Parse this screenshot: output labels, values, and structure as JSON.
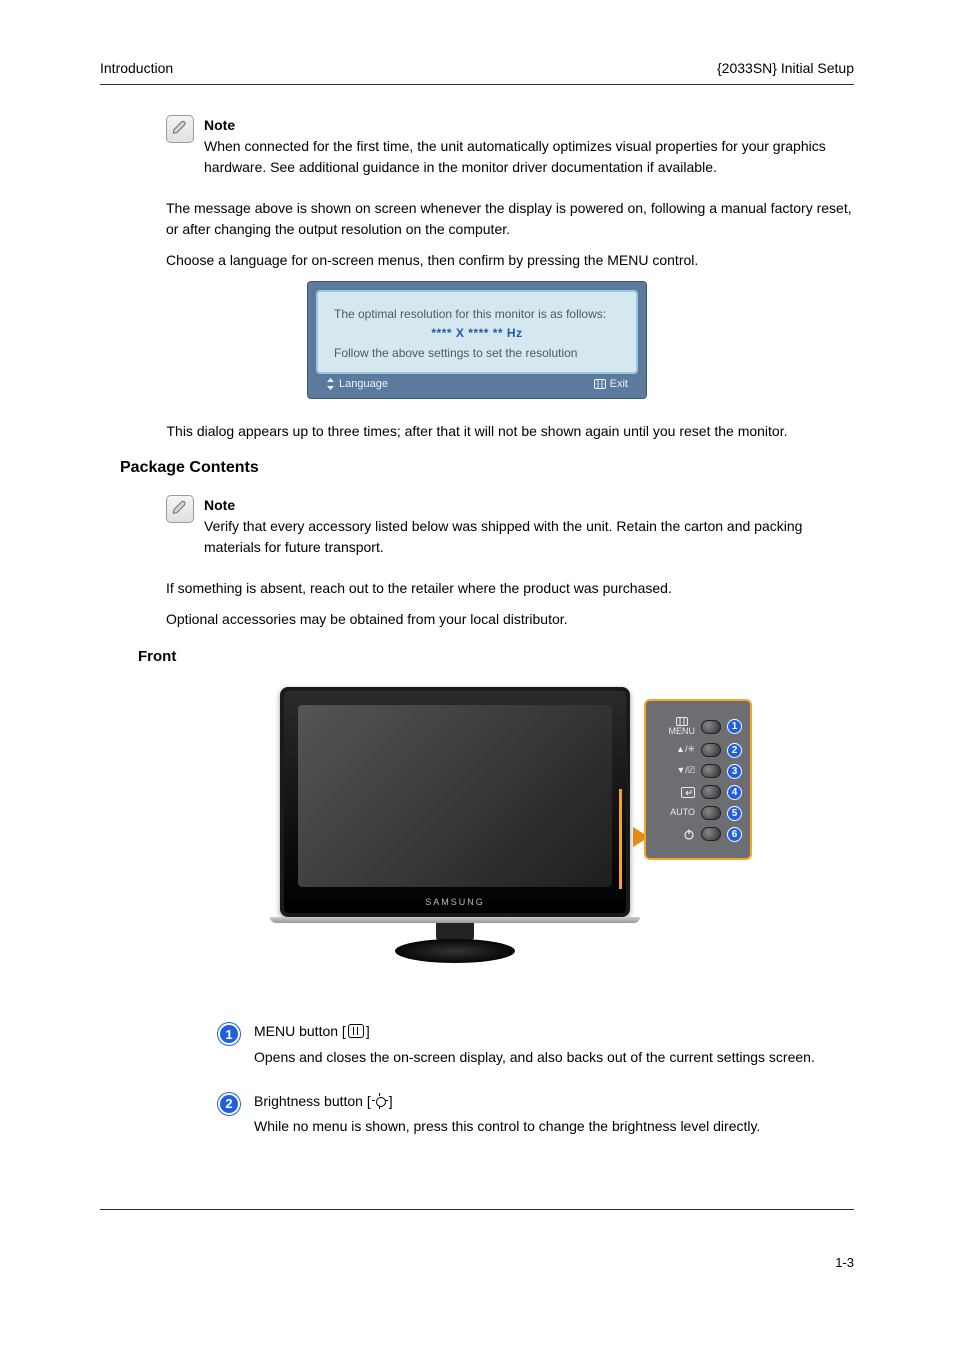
{
  "header": {
    "left": "Introduction",
    "right": "{2033SN} Initial Setup"
  },
  "footer": {
    "page_label": "1-3"
  },
  "osd": {
    "line1": "The optimal resolution for this monitor is as follows:",
    "res": "**** X **** ** Hz",
    "line2": "Follow the above settings to set the resolution",
    "bar_left_icon": "updown-icon",
    "bar_left": "Language",
    "bar_right_icon": "menu-icon",
    "bar_right": "Exit"
  },
  "sec1": {
    "note_label": "Note",
    "note": "When connected for the first time, the unit automatically optimizes visual properties for your graphics hardware. See additional guidance in the monitor driver documentation if available.",
    "p1": "The message above is shown on screen whenever the display is powered on, following a manual factory reset, or after changing the output resolution on the computer.",
    "p2": "Choose a language for on-screen menus, then confirm by pressing the MENU control.",
    "p3": "This dialog appears up to three times; after that it will not be shown again until you reset the monitor."
  },
  "sec2": {
    "title": "Package Contents",
    "note_label": "Note",
    "note": "Verify that every accessory listed below was shipped with the unit. Retain the carton and packing materials for future transport.",
    "p1": "If something is absent, reach out to the retailer where the product was purchased.",
    "p2": "Optional accessories may be obtained from your local distributor.",
    "subheading": "Front",
    "brand": "SAMSUNG"
  },
  "panel": {
    "rows": [
      {
        "label": "MENU",
        "icon": "menu-tiny-icon",
        "num": "1"
      },
      {
        "label": "▲/✳",
        "icon": "",
        "num": "2"
      },
      {
        "label": "▼/⎚",
        "icon": "",
        "num": "3"
      },
      {
        "label": "↵",
        "icon": "enter-icon",
        "num": "4"
      },
      {
        "label": "AUTO",
        "icon": "",
        "num": "5"
      },
      {
        "label": "⏻",
        "icon": "power-icon",
        "num": "6"
      }
    ]
  },
  "defs": [
    {
      "num": "1",
      "icon": "menu-icon",
      "term_before": "MENU button [",
      "term_after": "]",
      "explain": "Opens and closes the on-screen display, and also backs out of the current settings screen."
    },
    {
      "num": "2",
      "icon": "sun-icon",
      "term_before": "Brightness button [",
      "term_after": "]",
      "explain": "While no menu is shown, press this control to change the brightness level directly."
    }
  ]
}
